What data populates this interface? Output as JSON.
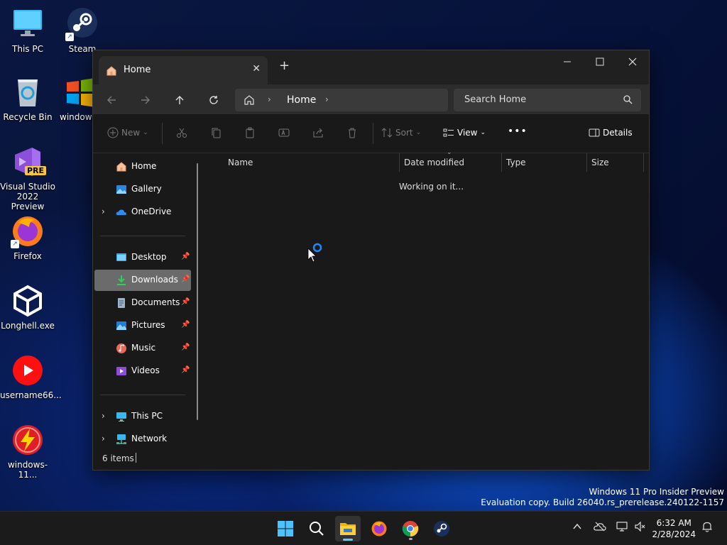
{
  "desktop": {
    "icons": [
      {
        "label": "This PC",
        "icon": "monitor-icon"
      },
      {
        "label": "Steam",
        "icon": "steam-icon"
      },
      {
        "label": "Recycle Bin",
        "icon": "recycle-bin-icon"
      },
      {
        "label": "windows",
        "icon": "windows-logo-icon"
      },
      {
        "label": "Visual Studio 2022 Preview",
        "icon": "visual-studio-icon",
        "badge": "PRE"
      },
      {
        "label": "Firefox",
        "icon": "firefox-icon"
      },
      {
        "label": "Longhell.exe",
        "icon": "unity-icon"
      },
      {
        "label": "username66...",
        "icon": "youtube-icon"
      },
      {
        "label": "windows-11...",
        "icon": "lightning-icon"
      }
    ]
  },
  "explorer": {
    "tab_title": "Home",
    "new_tab_label": "+",
    "address": {
      "segments": [
        "Home"
      ]
    },
    "search_placeholder": "Search Home",
    "commands": {
      "new": "New",
      "sort": "Sort",
      "view": "View",
      "more": "•••",
      "details": "Details"
    },
    "sidebar": {
      "top": [
        {
          "label": "Home",
          "icon": "home-icon"
        },
        {
          "label": "Gallery",
          "icon": "gallery-icon"
        },
        {
          "label": "OneDrive",
          "icon": "onedrive-icon",
          "expandable": true
        }
      ],
      "pinned": [
        {
          "label": "Desktop",
          "icon": "desktop-folder-icon",
          "pinned": true
        },
        {
          "label": "Downloads",
          "icon": "downloads-folder-icon",
          "pinned": true,
          "selected": true
        },
        {
          "label": "Documents",
          "icon": "documents-folder-icon",
          "pinned": true
        },
        {
          "label": "Pictures",
          "icon": "pictures-folder-icon",
          "pinned": true
        },
        {
          "label": "Music",
          "icon": "music-folder-icon",
          "pinned": true
        },
        {
          "label": "Videos",
          "icon": "videos-folder-icon",
          "pinned": true
        }
      ],
      "bottom": [
        {
          "label": "This PC",
          "icon": "this-pc-icon",
          "expandable": true
        },
        {
          "label": "Network",
          "icon": "network-icon",
          "expandable": true
        }
      ]
    },
    "columns": [
      "Name",
      "Date modified",
      "Type",
      "Size"
    ],
    "loading_text": "Working on it...",
    "status_text": "6 items"
  },
  "watermark": {
    "line1": "Windows 11 Pro Insider Preview",
    "line2": "Evaluation copy. Build 26040.rs_prerelease.240122-1157"
  },
  "taskbar": {
    "apps": [
      "start",
      "search",
      "file-explorer",
      "firefox",
      "chrome",
      "steam"
    ],
    "time": "6:32 AM",
    "date": "2/28/2024"
  }
}
